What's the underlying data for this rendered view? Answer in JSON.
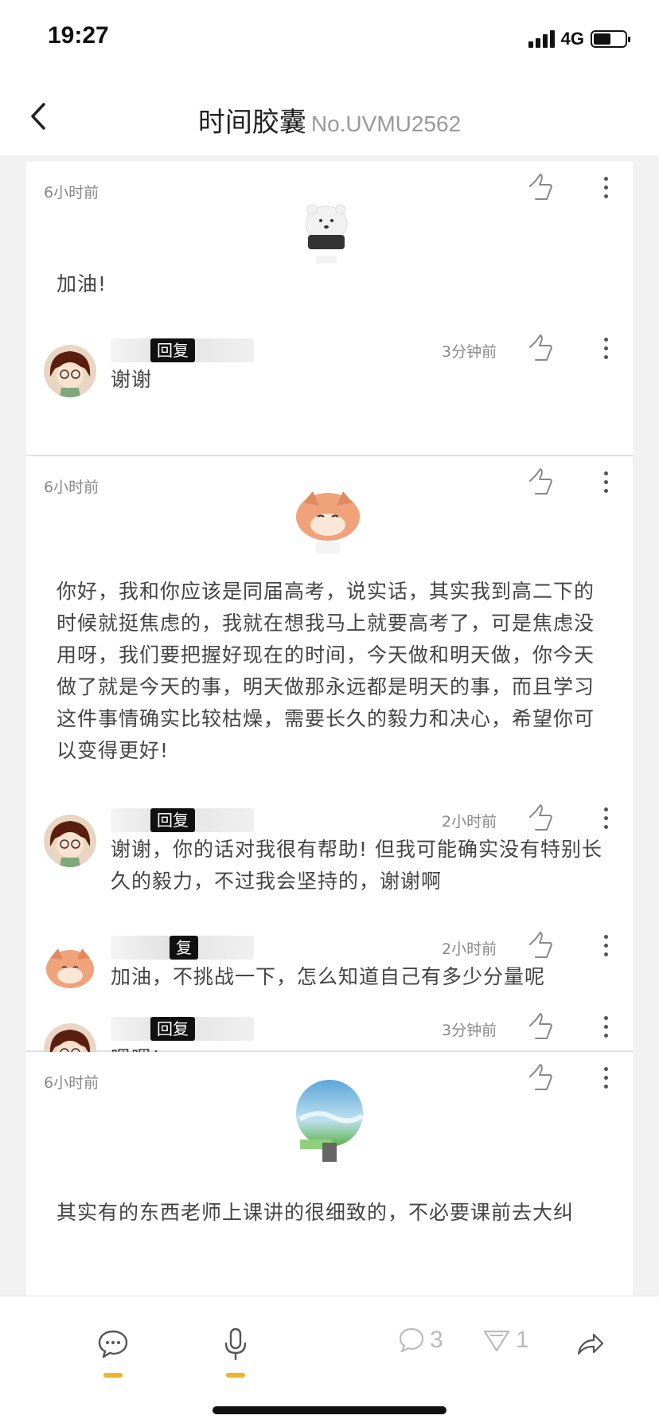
{
  "status_bar": {
    "time": "19:27",
    "network": "4G",
    "battery_level": 0.55
  },
  "header": {
    "title": "时间胶囊",
    "code": "No.UVMU2562"
  },
  "posts": [
    {
      "time": "6小时前",
      "text": "加油!",
      "avatar": "polar-bear",
      "replies": [
        {
          "tag": "回复",
          "time": "3分钟前",
          "text": "谢谢",
          "avatar": "girl-glasses"
        }
      ]
    },
    {
      "time": "6小时前",
      "text": "你好，我和你应该是同届高考，说实话，其实我到高二下的时候就挺焦虑的，我就在想我马上就要高考了，可是焦虑没用呀，我们要把握好现在的时间，今天做和明天做，你今天做了就是今天的事，明天做那永远都是明天的事，而且学习这件事情确实比较枯燥，需要长久的毅力和决心，希望你可以变得更好!",
      "avatar": "fox",
      "replies": [
        {
          "tag": "回复",
          "time": "2小时前",
          "text": "谢谢，你的话对我很有帮助! 但我可能确实没有特别长久的毅力，不过我会坚持的，谢谢啊",
          "avatar": "girl-glasses"
        },
        {
          "tag": "复",
          "time": "2小时前",
          "text": "加油，不挑战一下，怎么知道自己有多少分量呢",
          "avatar": "fox"
        },
        {
          "tag": "回复",
          "time": "3分钟前",
          "text": "嗯嗯!",
          "avatar": "girl-glasses"
        }
      ]
    },
    {
      "time": "6小时前",
      "text": "其实有的东西老师上课讲的很细致的，不必要课前去大纠",
      "avatar": "sky-globe",
      "replies": []
    }
  ],
  "bottom_bar": {
    "comment_count": "3",
    "like_count": "1"
  }
}
